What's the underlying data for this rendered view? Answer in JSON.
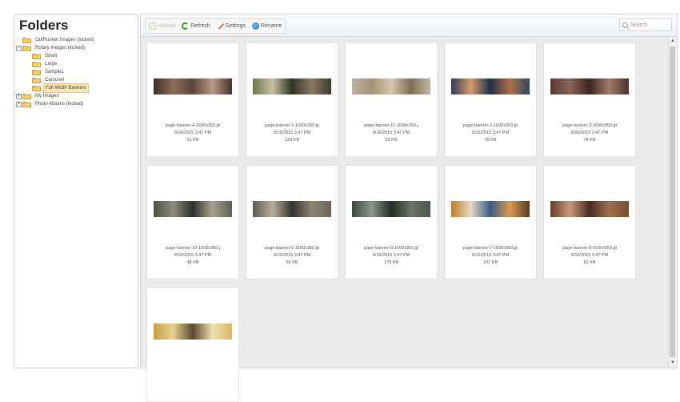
{
  "sidebar": {
    "title": "Folders",
    "items": [
      {
        "label": "OutRunner Images (locked)",
        "toggle": "",
        "indent": 0
      },
      {
        "label": "Rotary Images (locked)",
        "toggle": "−",
        "indent": 0
      },
      {
        "label": "Small",
        "toggle": "",
        "indent": 1
      },
      {
        "label": "Large",
        "toggle": "",
        "indent": 1
      },
      {
        "label": "Sample1",
        "toggle": "",
        "indent": 1
      },
      {
        "label": "Carousel",
        "toggle": "",
        "indent": 1
      },
      {
        "label": "Full Width Banners",
        "toggle": "",
        "indent": 1,
        "selected": true
      },
      {
        "label": "My Images",
        "toggle": "+",
        "indent": 0
      },
      {
        "label": "Photo Albums (locked)",
        "toggle": "+",
        "indent": 0
      }
    ]
  },
  "toolbar": {
    "upload_label": "Upload",
    "refresh_label": "Refresh",
    "settings_label": "Settings",
    "rename_label": "Rename",
    "search_placeholder": "Search"
  },
  "files": [
    {
      "name": "page-banner-4-1600x350.jp",
      "date": "9/16/2015 3:47 PM",
      "size": "51 KB",
      "colors": [
        "#3c2e26",
        "#8c6d58",
        "#5a463a",
        "#b89a86",
        "#413229"
      ]
    },
    {
      "name": "page-banner-1-1600x350.jp",
      "date": "9/16/2015 3:47 PM",
      "size": "120 KB",
      "colors": [
        "#6a7a4a",
        "#c9bfa4",
        "#2f3327",
        "#8a7b64",
        "#3a3b2e"
      ]
    },
    {
      "name": "page-banner-11-1600x350.j",
      "date": "9/16/2015 3:47 PM",
      "size": "53 KB",
      "colors": [
        "#b8b39a",
        "#a4927a",
        "#d3c8b0",
        "#7d6e5a",
        "#c2b7a0"
      ]
    },
    {
      "name": "page-banner-2-1600x350.jp",
      "date": "9/16/2015 3:47 PM",
      "size": "78 KB",
      "colors": [
        "#2c3e5c",
        "#d49c6c",
        "#1f2f48",
        "#b07048",
        "#30455f"
      ]
    },
    {
      "name": "page-banner-3-1600x350.jp",
      "date": "9/16/2015 3:47 PM",
      "size": "74 KB",
      "colors": [
        "#5a3a34",
        "#8b6258",
        "#3b2522",
        "#a27a6c",
        "#4a302b"
      ]
    },
    {
      "name": "page-banner-10-1600x350.j",
      "date": "9/16/2015 3:47 PM",
      "size": "48 KB",
      "colors": [
        "#4d5048",
        "#8e8a7c",
        "#2e302c",
        "#a8a190",
        "#5b5e55"
      ]
    },
    {
      "name": "page-banner-5-1600x350.jp",
      "date": "9/16/2015 3:47 PM",
      "size": "66 KB",
      "colors": [
        "#5d5a52",
        "#b8ad9a",
        "#35332e",
        "#8d8574",
        "#6b665b"
      ]
    },
    {
      "name": "page-banner-6-1600x350.jp",
      "date": "9/16/2015 3:47 PM",
      "size": "178 KB",
      "colors": [
        "#3a4840",
        "#8c968a",
        "#232c26",
        "#6c7468",
        "#4a5650"
      ]
    },
    {
      "name": "page-banner-7-1600x350.jp",
      "date": "9/16/2015 3:47 PM",
      "size": "101 KB",
      "colors": [
        "#c47a28",
        "#e8d8c0",
        "#3a5a8a",
        "#d89a4a",
        "#5a3a22"
      ]
    },
    {
      "name": "page-banner-8-1600x350.jp",
      "date": "9/16/2015 3:47 PM",
      "size": "81 KB",
      "colors": [
        "#6a3d2a",
        "#c89a78",
        "#4a2a1e",
        "#a0704e",
        "#7a4a32"
      ]
    },
    {
      "name": "",
      "date": "",
      "size": "",
      "colors": [
        "#c8a040",
        "#e8d090",
        "#5a4a30",
        "#f0e0b0",
        "#d8b860"
      ]
    }
  ]
}
